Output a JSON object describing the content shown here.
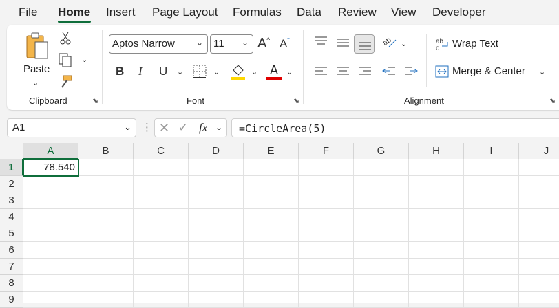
{
  "menu": {
    "tabs": [
      {
        "label": "File"
      },
      {
        "label": "Home"
      },
      {
        "label": "Insert"
      },
      {
        "label": "Page Layout"
      },
      {
        "label": "Formulas"
      },
      {
        "label": "Data"
      },
      {
        "label": "Review"
      },
      {
        "label": "View"
      },
      {
        "label": "Developer"
      }
    ],
    "active_tab": "Home",
    "accent_color": "#0f6e3b"
  },
  "ribbon": {
    "clipboard": {
      "label": "Clipboard",
      "paste_label": "Paste",
      "icons": [
        "paste-icon",
        "cut-icon",
        "copy-icon",
        "format-painter-icon"
      ]
    },
    "font": {
      "label": "Font",
      "font_name": "Aptos Narrow",
      "font_size": "11",
      "bold": "B",
      "italic": "I",
      "underline": "U",
      "grow": "A",
      "shrink": "A",
      "font_color": "A",
      "highlight_color": "#ffd800",
      "font_color_value": "#e00000"
    },
    "alignment": {
      "label": "Alignment",
      "wrap_text": "Wrap Text",
      "merge_center": "Merge & Center"
    }
  },
  "formula_bar": {
    "name_box": "A1",
    "formula": "=CircleArea(5)",
    "fx": "fx"
  },
  "sheet": {
    "columns": [
      "A",
      "B",
      "C",
      "D",
      "E",
      "F",
      "G",
      "H",
      "I",
      "J"
    ],
    "rows": [
      "1",
      "2",
      "3",
      "4",
      "5",
      "6",
      "7",
      "8",
      "9"
    ],
    "active_cell": "A1",
    "cells": {
      "A1": "78.540"
    }
  }
}
